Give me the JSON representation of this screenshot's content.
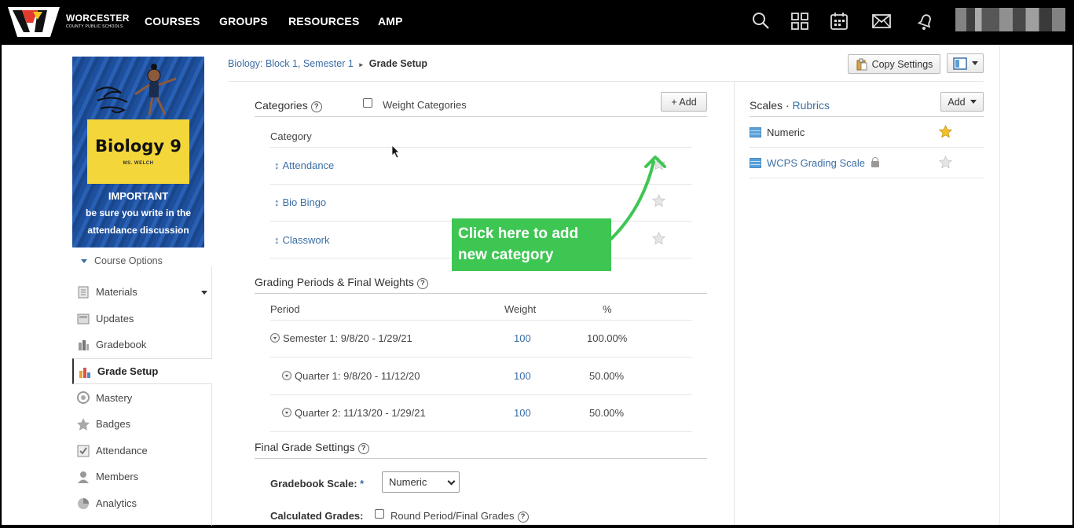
{
  "brand": {
    "name": "WORCESTER",
    "subtitle": "COUNTY PUBLIC SCHOOLS"
  },
  "nav": {
    "links": [
      "COURSES",
      "GROUPS",
      "RESOURCES",
      "AMP"
    ],
    "icons": [
      "search-icon",
      "apps-grid-icon",
      "calendar-icon",
      "mail-icon",
      "notifications-bell-icon"
    ]
  },
  "course_card": {
    "title": "Biology 9",
    "teacher": "MS. WELCH",
    "important": "IMPORTANT",
    "line1": "be sure you write in the",
    "line2": "attendance discussion"
  },
  "sidebar": {
    "course_options": "Course Options",
    "items": [
      {
        "label": "Materials",
        "icon": "materials-icon"
      },
      {
        "label": "Updates",
        "icon": "updates-icon"
      },
      {
        "label": "Gradebook",
        "icon": "gradebook-icon"
      },
      {
        "label": "Grade Setup",
        "icon": "grade-setup-icon",
        "active": true
      },
      {
        "label": "Mastery",
        "icon": "mastery-icon"
      },
      {
        "label": "Badges",
        "icon": "badges-icon"
      },
      {
        "label": "Attendance",
        "icon": "attendance-icon"
      },
      {
        "label": "Members",
        "icon": "members-icon"
      },
      {
        "label": "Analytics",
        "icon": "analytics-icon"
      }
    ]
  },
  "breadcrumb": {
    "parent": "Biology: Block 1, Semester 1",
    "current": "Grade Setup"
  },
  "toolbar": {
    "copy_settings": "Copy Settings"
  },
  "categories": {
    "title": "Categories",
    "weight_label": "Weight Categories",
    "add_label": "+ Add",
    "column_header": "Category",
    "items": [
      "Attendance",
      "Bio Bingo",
      "Classwork"
    ]
  },
  "annotation": {
    "line1": "Click here to add",
    "line2": "new category"
  },
  "grading_periods": {
    "title": "Grading Periods & Final Weights",
    "col_period": "Period",
    "col_weight": "Weight",
    "col_pct": "%",
    "rows": [
      {
        "period": "Semester 1: 9/8/20 - 1/29/21",
        "weight": "100",
        "pct": "100.00%"
      },
      {
        "period": "Quarter 1: 9/8/20 - 11/12/20",
        "weight": "100",
        "pct": "50.00%"
      },
      {
        "period": "Quarter 2: 11/13/20 - 1/29/21",
        "weight": "100",
        "pct": "50.00%"
      }
    ]
  },
  "final_grade": {
    "title": "Final Grade Settings",
    "scale_label": "Gradebook Scale:",
    "required_mark": "*",
    "scale_value": "Numeric",
    "calc_label": "Calculated Grades:",
    "round_label": "Round Period/Final Grades"
  },
  "scales": {
    "title": "Scales",
    "dot": "·",
    "rubrics": "Rubrics",
    "add_label": "Add",
    "items": [
      "Numeric",
      "WCPS Grading Scale"
    ]
  },
  "colors": {
    "link": "#3b6ea5",
    "callout": "#3ec653",
    "star_default": "#f2c12e"
  }
}
